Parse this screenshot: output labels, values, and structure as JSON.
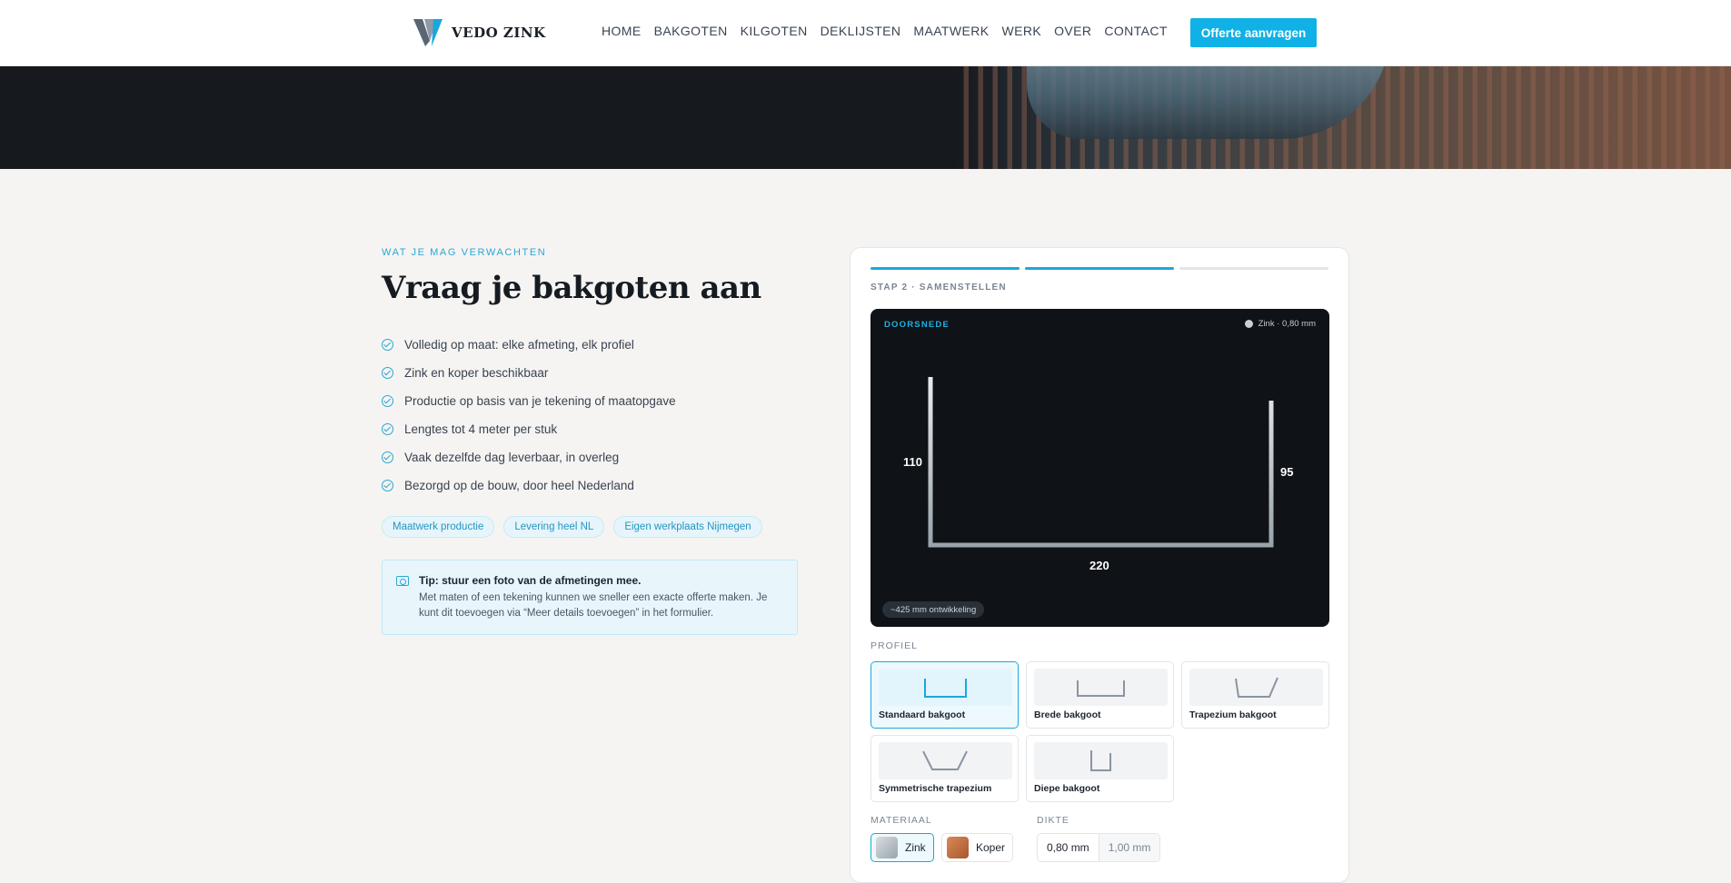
{
  "header": {
    "brand": "VEDO ZINK",
    "nav": [
      "HOME",
      "BAKGOTEN",
      "KILGOTEN",
      "DEKLIJSTEN",
      "MAATWERK",
      "WERK",
      "OVER",
      "CONTACT"
    ],
    "cta": "Offerte aanvragen",
    "accent": "#0fb1e6"
  },
  "intro": {
    "eyebrow": "WAT JE MAG VERWACHTEN",
    "title": "Vraag je bakgoten aan",
    "checklist": [
      "Volledig op maat: elke afmeting, elk profiel",
      "Zink en koper beschikbaar",
      "Productie op basis van je tekening of maatopgave",
      "Lengtes tot 4 meter per stuk",
      "Vaak dezelfde dag leverbaar, in overleg",
      "Bezorgd op de bouw, door heel Nederland"
    ],
    "chips": [
      "Maatwerk productie",
      "Levering heel NL",
      "Eigen werkplaats Nijmegen"
    ],
    "tip": {
      "icon": "camera-icon",
      "title": "Tip: stuur een foto van de afmetingen mee.",
      "body": "Met maten of een tekening kunnen we sneller een exacte offerte maken. Je kunt dit toevoegen via “Meer details toevoegen” in het formulier."
    }
  },
  "configurator": {
    "steps_total": 3,
    "steps_active": 2,
    "step_label": "STAP 2 · SAMENSTELLEN",
    "preview": {
      "label": "DOORSNEDE",
      "material": "Zink · 0,80 mm",
      "dim_left": "110",
      "dim_right": "95",
      "dim_bottom": "220",
      "development": "~425 mm ontwikkeling"
    },
    "profile_label": "PROFIEL",
    "profiles": [
      {
        "name": "Standaard bakgoot",
        "selected": true
      },
      {
        "name": "Brede bakgoot",
        "selected": false
      },
      {
        "name": "Trapezium bakgoot",
        "selected": false
      },
      {
        "name": "Symmetrische trapezium",
        "selected": false
      },
      {
        "name": "Diepe bakgoot",
        "selected": false
      }
    ],
    "material_label": "MATERIAAL",
    "materials": [
      {
        "name": "Zink",
        "selected": true,
        "color": "#b8c0c8"
      },
      {
        "name": "Koper",
        "selected": false,
        "color": "#c06a3a"
      }
    ],
    "thickness_label": "DIKTE",
    "thickness": [
      {
        "value": "0,80 mm",
        "selected": true
      },
      {
        "value": "1,00 mm",
        "selected": false
      }
    ]
  }
}
